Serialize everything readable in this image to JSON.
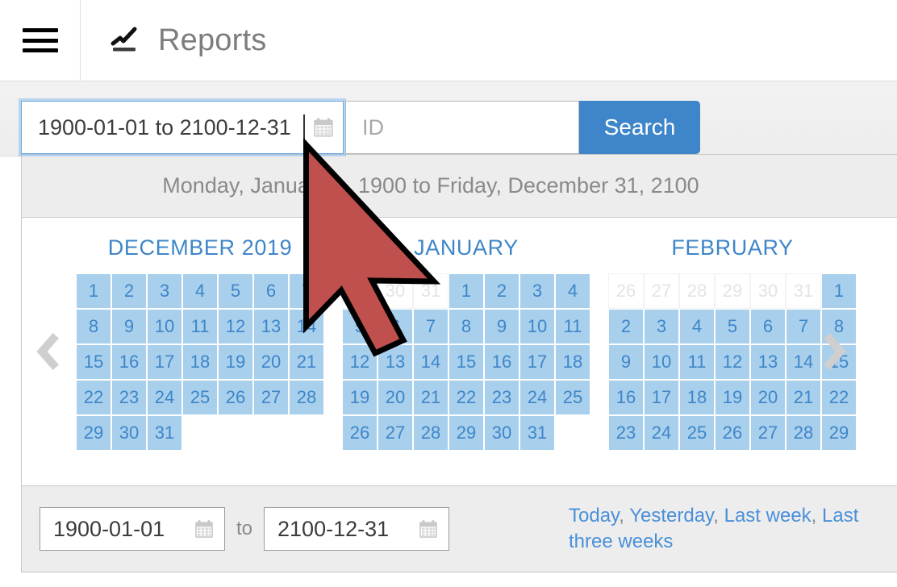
{
  "appbar": {
    "menu_icon": "hamburger-icon",
    "brand_icon": "line-chart-icon",
    "title": "Reports"
  },
  "search": {
    "daterange_value": "1900-01-01 to 2100-12-31",
    "daterange_calendar_icon": "calendar-icon",
    "id_placeholder": "ID",
    "id_value": "",
    "search_label": "Search"
  },
  "dropdown": {
    "summary": "Monday, January 1, 1900 to Friday, December 31, 2100",
    "prev_icon": "chevron-left-icon",
    "next_icon": "chevron-right-icon",
    "months": [
      {
        "name": "DECEMBER 2019",
        "weeks": [
          [
            {
              "d": "1",
              "s": "in"
            },
            {
              "d": "2",
              "s": "in"
            },
            {
              "d": "3",
              "s": "in"
            },
            {
              "d": "4",
              "s": "in"
            },
            {
              "d": "5",
              "s": "in"
            },
            {
              "d": "6",
              "s": "in"
            },
            {
              "d": "7",
              "s": "in"
            }
          ],
          [
            {
              "d": "8",
              "s": "in"
            },
            {
              "d": "9",
              "s": "in"
            },
            {
              "d": "10",
              "s": "in"
            },
            {
              "d": "11",
              "s": "in"
            },
            {
              "d": "12",
              "s": "in"
            },
            {
              "d": "13",
              "s": "in"
            },
            {
              "d": "14",
              "s": "in"
            }
          ],
          [
            {
              "d": "15",
              "s": "in"
            },
            {
              "d": "16",
              "s": "in"
            },
            {
              "d": "17",
              "s": "in"
            },
            {
              "d": "18",
              "s": "in"
            },
            {
              "d": "19",
              "s": "in"
            },
            {
              "d": "20",
              "s": "in"
            },
            {
              "d": "21",
              "s": "in"
            }
          ],
          [
            {
              "d": "22",
              "s": "in"
            },
            {
              "d": "23",
              "s": "in"
            },
            {
              "d": "24",
              "s": "in"
            },
            {
              "d": "25",
              "s": "in"
            },
            {
              "d": "26",
              "s": "in"
            },
            {
              "d": "27",
              "s": "in"
            },
            {
              "d": "28",
              "s": "in"
            }
          ],
          [
            {
              "d": "29",
              "s": "in"
            },
            {
              "d": "30",
              "s": "in"
            },
            {
              "d": "31",
              "s": "in"
            },
            {
              "d": "",
              "s": "empty"
            },
            {
              "d": "",
              "s": "empty"
            },
            {
              "d": "",
              "s": "empty"
            },
            {
              "d": "",
              "s": "empty"
            }
          ]
        ]
      },
      {
        "name": "JANUARY",
        "weeks": [
          [
            {
              "d": "29",
              "s": "muted"
            },
            {
              "d": "30",
              "s": "muted"
            },
            {
              "d": "31",
              "s": "muted"
            },
            {
              "d": "1",
              "s": "in"
            },
            {
              "d": "2",
              "s": "in"
            },
            {
              "d": "3",
              "s": "in"
            },
            {
              "d": "4",
              "s": "in"
            }
          ],
          [
            {
              "d": "5",
              "s": "in"
            },
            {
              "d": "6",
              "s": "in"
            },
            {
              "d": "7",
              "s": "in"
            },
            {
              "d": "8",
              "s": "in"
            },
            {
              "d": "9",
              "s": "in"
            },
            {
              "d": "10",
              "s": "in"
            },
            {
              "d": "11",
              "s": "in"
            }
          ],
          [
            {
              "d": "12",
              "s": "in"
            },
            {
              "d": "13",
              "s": "in"
            },
            {
              "d": "14",
              "s": "in"
            },
            {
              "d": "15",
              "s": "in"
            },
            {
              "d": "16",
              "s": "in"
            },
            {
              "d": "17",
              "s": "in"
            },
            {
              "d": "18",
              "s": "in"
            }
          ],
          [
            {
              "d": "19",
              "s": "in"
            },
            {
              "d": "20",
              "s": "in"
            },
            {
              "d": "21",
              "s": "in"
            },
            {
              "d": "22",
              "s": "in"
            },
            {
              "d": "23",
              "s": "in"
            },
            {
              "d": "24",
              "s": "in"
            },
            {
              "d": "25",
              "s": "in"
            }
          ],
          [
            {
              "d": "26",
              "s": "in"
            },
            {
              "d": "27",
              "s": "in"
            },
            {
              "d": "28",
              "s": "in"
            },
            {
              "d": "29",
              "s": "in"
            },
            {
              "d": "30",
              "s": "in"
            },
            {
              "d": "31",
              "s": "in"
            },
            {
              "d": "",
              "s": "empty"
            }
          ]
        ]
      },
      {
        "name": "FEBRUARY",
        "weeks": [
          [
            {
              "d": "26",
              "s": "muted"
            },
            {
              "d": "27",
              "s": "muted"
            },
            {
              "d": "28",
              "s": "muted"
            },
            {
              "d": "29",
              "s": "muted"
            },
            {
              "d": "30",
              "s": "muted"
            },
            {
              "d": "31",
              "s": "muted"
            },
            {
              "d": "1",
              "s": "in"
            }
          ],
          [
            {
              "d": "2",
              "s": "in"
            },
            {
              "d": "3",
              "s": "in"
            },
            {
              "d": "4",
              "s": "in"
            },
            {
              "d": "5",
              "s": "in"
            },
            {
              "d": "6",
              "s": "in"
            },
            {
              "d": "7",
              "s": "in"
            },
            {
              "d": "8",
              "s": "in"
            }
          ],
          [
            {
              "d": "9",
              "s": "in"
            },
            {
              "d": "10",
              "s": "in"
            },
            {
              "d": "11",
              "s": "in"
            },
            {
              "d": "12",
              "s": "in"
            },
            {
              "d": "13",
              "s": "in"
            },
            {
              "d": "14",
              "s": "in"
            },
            {
              "d": "15",
              "s": "in"
            }
          ],
          [
            {
              "d": "16",
              "s": "in"
            },
            {
              "d": "17",
              "s": "in"
            },
            {
              "d": "18",
              "s": "in"
            },
            {
              "d": "19",
              "s": "in"
            },
            {
              "d": "20",
              "s": "in"
            },
            {
              "d": "21",
              "s": "in"
            },
            {
              "d": "22",
              "s": "in"
            }
          ],
          [
            {
              "d": "23",
              "s": "in"
            },
            {
              "d": "24",
              "s": "in"
            },
            {
              "d": "25",
              "s": "in"
            },
            {
              "d": "26",
              "s": "in"
            },
            {
              "d": "27",
              "s": "in"
            },
            {
              "d": "28",
              "s": "in"
            },
            {
              "d": "29",
              "s": "in"
            }
          ]
        ]
      }
    ],
    "footer": {
      "start_date": "1900-01-01",
      "end_date": "2100-12-31",
      "to_label": "to",
      "start_calendar_icon": "calendar-icon",
      "end_calendar_icon": "calendar-icon",
      "quick_links": [
        "Today",
        "Yesterday",
        "Last week",
        "Last three weeks"
      ],
      "separator": ", "
    }
  },
  "cursor": {
    "icon": "mouse-pointer-arrow",
    "color": "#c0504d"
  },
  "colors": {
    "accent_blue": "#3e86c9",
    "day_in_range": "#a8cfec",
    "day_muted_text": "#e4e4e4",
    "panel_grey": "#ededed"
  }
}
